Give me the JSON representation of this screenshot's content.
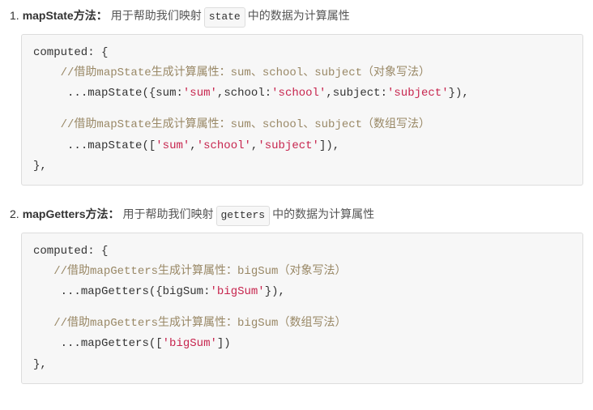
{
  "sections": [
    {
      "num": "1.",
      "method": "mapState方法",
      "colon": "：",
      "desc_pre": "用于帮助我们映射",
      "desc_code": "state",
      "desc_post": "中的数据为计算属性",
      "code": {
        "line1_key": "computed",
        "line1_punc": ": {",
        "comment1": "//借助mapState生成计算属性：sum、school、subject（对象写法）",
        "spread": "...",
        "fn": "mapState",
        "obj_open": "({",
        "k1": "sum",
        "c": ":",
        "v1": "'sum'",
        "k2": "school",
        "v2": "'school'",
        "k3": "subject",
        "v3": "'subject'",
        "obj_close": "}),",
        "comment2": "//借助mapState生成计算属性：sum、school、subject（数组写法）",
        "arr_open": "([",
        "av1": "'sum'",
        "av2": "'school'",
        "av3": "'subject'",
        "arr_close": "]),",
        "end": "},"
      }
    },
    {
      "num": "2.",
      "method": "mapGetters方法",
      "colon": "：",
      "desc_pre": "用于帮助我们映射",
      "desc_code": "getters",
      "desc_post": "中的数据为计算属性",
      "code": {
        "line1_key": "computed",
        "line1_punc": ": {",
        "comment1": "//借助mapGetters生成计算属性：bigSum（对象写法）",
        "spread": "...",
        "fn": "mapGetters",
        "obj_open": "({",
        "k1": "bigSum",
        "c": ":",
        "v1": "'bigSum'",
        "obj_close": "}),",
        "comment2": "//借助mapGetters生成计算属性：bigSum（数组写法）",
        "arr_open": "([",
        "av1": "'bigSum'",
        "arr_close": "])",
        "end": "},"
      }
    }
  ]
}
